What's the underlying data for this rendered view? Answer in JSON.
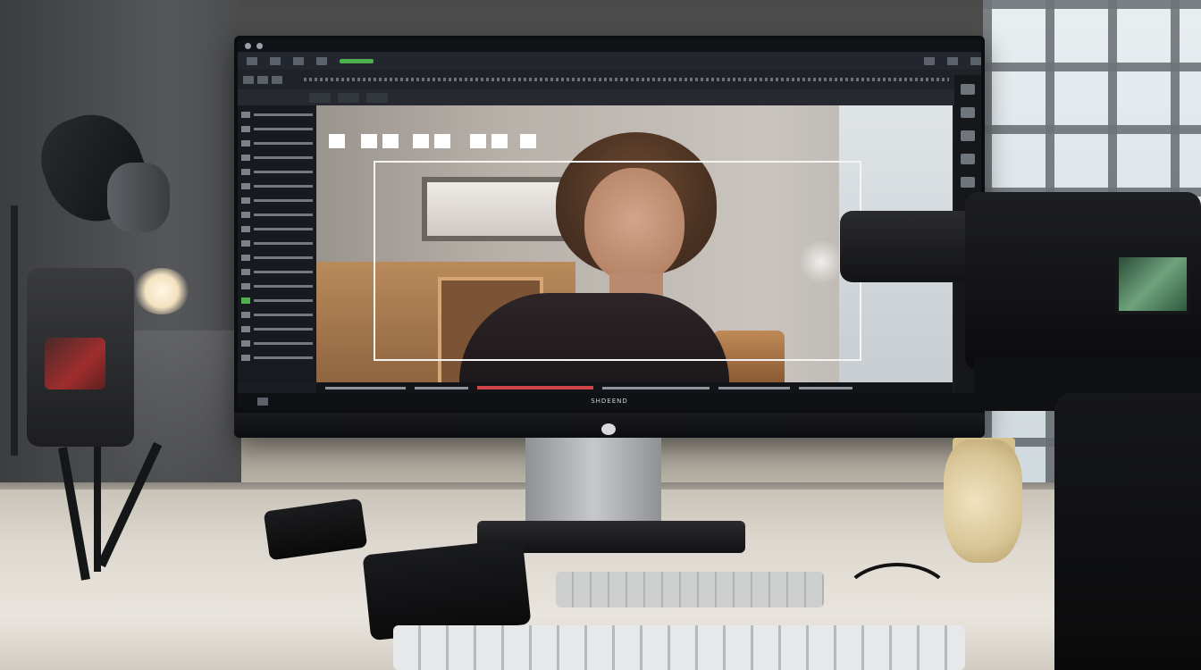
{
  "scene": {
    "description_colors": {
      "accent_green": "#4caf50",
      "timeline_red": "#d0454a",
      "monitor_bezel": "#0c0d10"
    }
  },
  "monitor": {
    "app": {
      "status_label": "SHDEEND"
    }
  }
}
